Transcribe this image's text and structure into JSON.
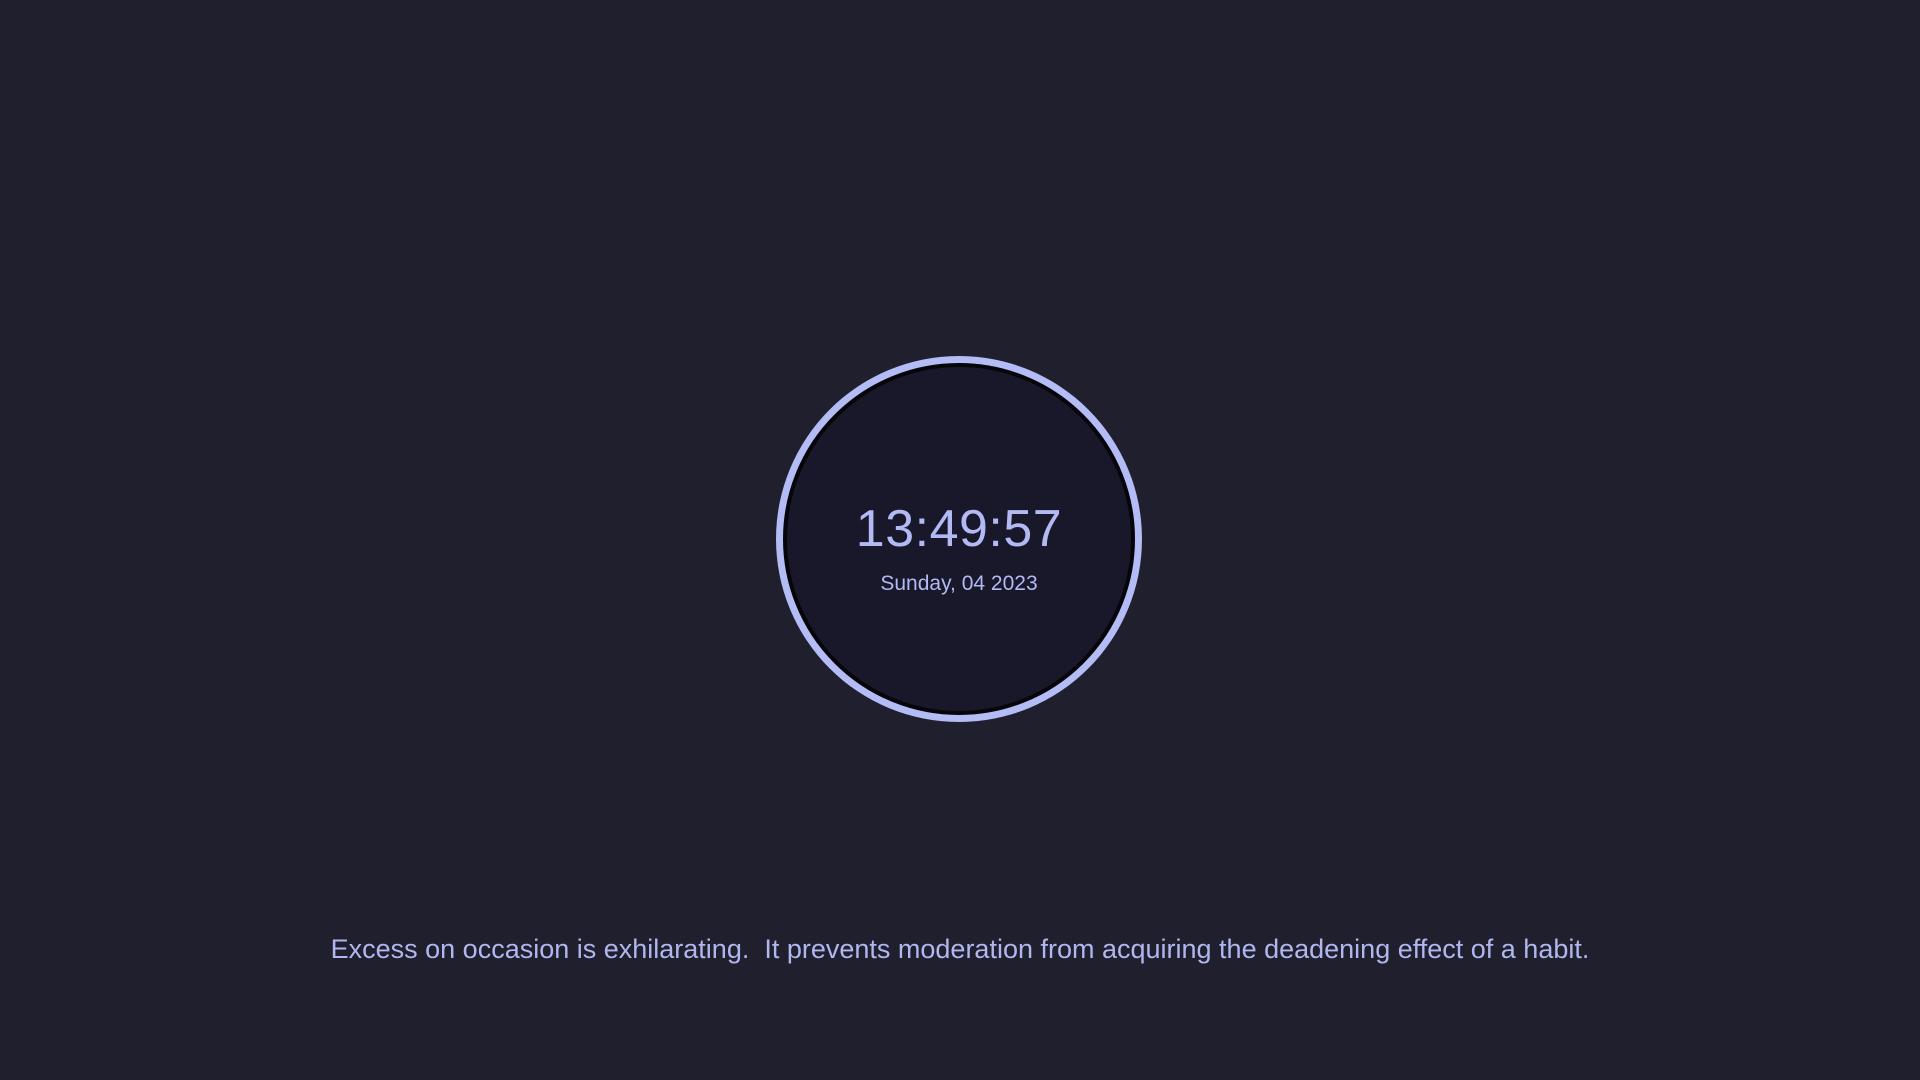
{
  "clock": {
    "time": "13:49:57",
    "date": "Sunday, 04 2023"
  },
  "quote": {
    "text": "Excess on occasion is exhilarating.  It prevents moderation from acquiring the deadening effect of a habit."
  },
  "colors": {
    "background": "#1f1f2e",
    "accent": "#b4bcf6",
    "clock_face": "#18182a",
    "text": "#b3b9f3"
  }
}
